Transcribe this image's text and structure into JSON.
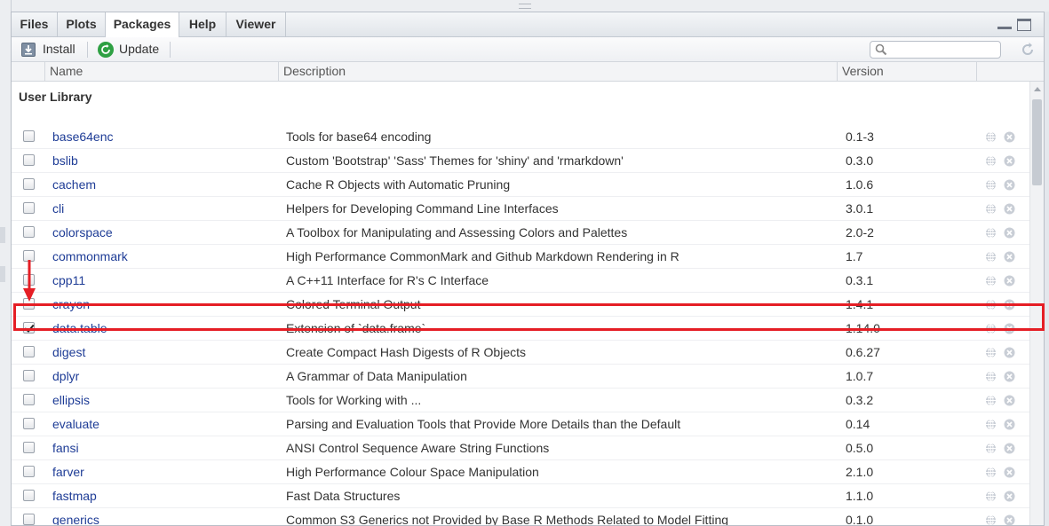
{
  "tabs": [
    {
      "label": "Files",
      "active": false
    },
    {
      "label": "Plots",
      "active": false
    },
    {
      "label": "Packages",
      "active": true
    },
    {
      "label": "Help",
      "active": false
    },
    {
      "label": "Viewer",
      "active": false
    }
  ],
  "toolbar": {
    "install_label": "Install",
    "update_label": "Update",
    "search_value": "",
    "search_placeholder": ""
  },
  "columns": {
    "name": "Name",
    "description": "Description",
    "version": "Version"
  },
  "library_label": "User Library",
  "packages": [
    {
      "name": "base64enc",
      "description": "Tools for base64 encoding",
      "version": "0.1-3",
      "checked": false
    },
    {
      "name": "bslib",
      "description": "Custom 'Bootstrap' 'Sass' Themes for 'shiny' and 'rmarkdown'",
      "version": "0.3.0",
      "checked": false
    },
    {
      "name": "cachem",
      "description": "Cache R Objects with Automatic Pruning",
      "version": "1.0.6",
      "checked": false
    },
    {
      "name": "cli",
      "description": "Helpers for Developing Command Line Interfaces",
      "version": "3.0.1",
      "checked": false
    },
    {
      "name": "colorspace",
      "description": "A Toolbox for Manipulating and Assessing Colors and Palettes",
      "version": "2.0-2",
      "checked": false
    },
    {
      "name": "commonmark",
      "description": "High Performance CommonMark and Github Markdown Rendering in R",
      "version": "1.7",
      "checked": false
    },
    {
      "name": "cpp11",
      "description": "A C++11 Interface for R's C Interface",
      "version": "0.3.1",
      "checked": false
    },
    {
      "name": "crayon",
      "description": "Colored Terminal Output",
      "version": "1.4.1",
      "checked": false
    },
    {
      "name": "data.table",
      "description": "Extension of `data.frame`",
      "version": "1.14.0",
      "checked": true
    },
    {
      "name": "digest",
      "description": "Create Compact Hash Digests of R Objects",
      "version": "0.6.27",
      "checked": false
    },
    {
      "name": "dplyr",
      "description": "A Grammar of Data Manipulation",
      "version": "1.0.7",
      "checked": false
    },
    {
      "name": "ellipsis",
      "description": "Tools for Working with ...",
      "version": "0.3.2",
      "checked": false
    },
    {
      "name": "evaluate",
      "description": "Parsing and Evaluation Tools that Provide More Details than the Default",
      "version": "0.14",
      "checked": false
    },
    {
      "name": "fansi",
      "description": "ANSI Control Sequence Aware String Functions",
      "version": "0.5.0",
      "checked": false
    },
    {
      "name": "farver",
      "description": "High Performance Colour Space Manipulation",
      "version": "2.1.0",
      "checked": false
    },
    {
      "name": "fastmap",
      "description": "Fast Data Structures",
      "version": "1.1.0",
      "checked": false
    },
    {
      "name": "generics",
      "description": "Common S3 Generics not Provided by Base R Methods Related to Model Fitting",
      "version": "0.1.0",
      "checked": false
    }
  ],
  "colors": {
    "package_link": "#1e3c96",
    "highlight": "#e51e25",
    "update_icon": "#2ea043"
  }
}
